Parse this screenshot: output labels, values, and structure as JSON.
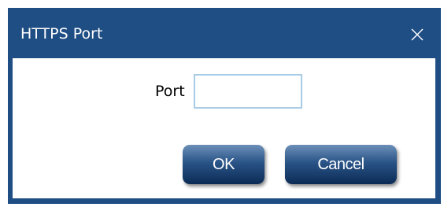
{
  "dialog": {
    "title": "HTTPS Port",
    "close_icon": "close-icon",
    "port_label": "Port",
    "port_value": "",
    "ok_label": "OK",
    "cancel_label": "Cancel"
  },
  "colors": {
    "frame": "#1f4e84",
    "content_bg": "#ffffff",
    "input_border": "#a8cbe6",
    "button_top": "#6b8fb8",
    "button_bottom": "#0b2b55"
  }
}
